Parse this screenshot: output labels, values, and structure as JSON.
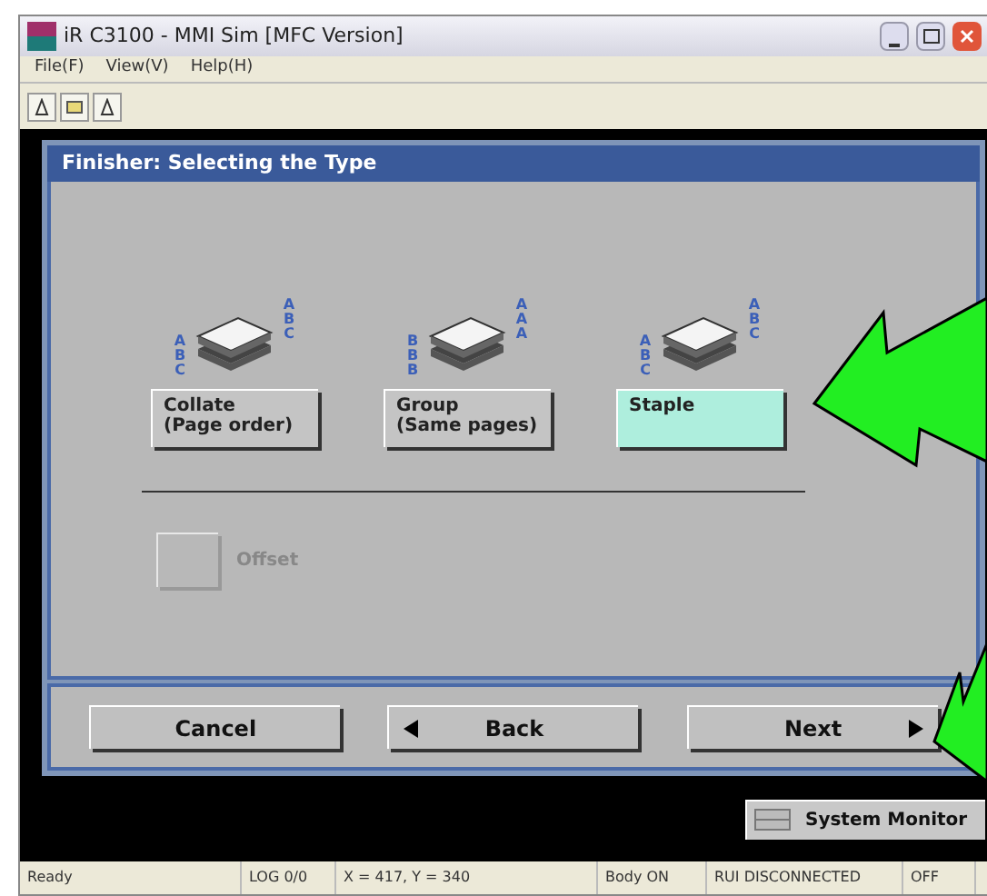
{
  "window": {
    "title": "iR C3100 - MMI Sim [MFC Version]"
  },
  "menu": [
    "File(F)",
    "View(V)",
    "Help(H)"
  ],
  "dialog": {
    "title": "Finisher: Selecting the Type",
    "options": [
      {
        "label_lines": [
          "Collate",
          "(Page order)"
        ],
        "left_letters": "ABC",
        "right_letters": "ABC",
        "selected": false
      },
      {
        "label_lines": [
          "Group",
          "(Same pages)"
        ],
        "left_letters": "BBB",
        "right_letters": "AAA",
        "selected": false
      },
      {
        "label_lines": [
          "Staple"
        ],
        "left_letters": "ABC",
        "right_letters": "ABC",
        "selected": true
      }
    ],
    "offset": {
      "label": "Offset",
      "checked": false,
      "disabled": true
    },
    "buttons": [
      {
        "label": "Cancel",
        "kind": "plain"
      },
      {
        "label": "Back",
        "kind": "back"
      },
      {
        "label": "Next",
        "kind": "next"
      }
    ]
  },
  "system_monitor": "System Monitor",
  "status_bar": [
    "Ready",
    "LOG 0/0",
    "X =  417, Y =  340",
    "Body ON",
    "RUI DISCONNECTED",
    "OFF"
  ]
}
